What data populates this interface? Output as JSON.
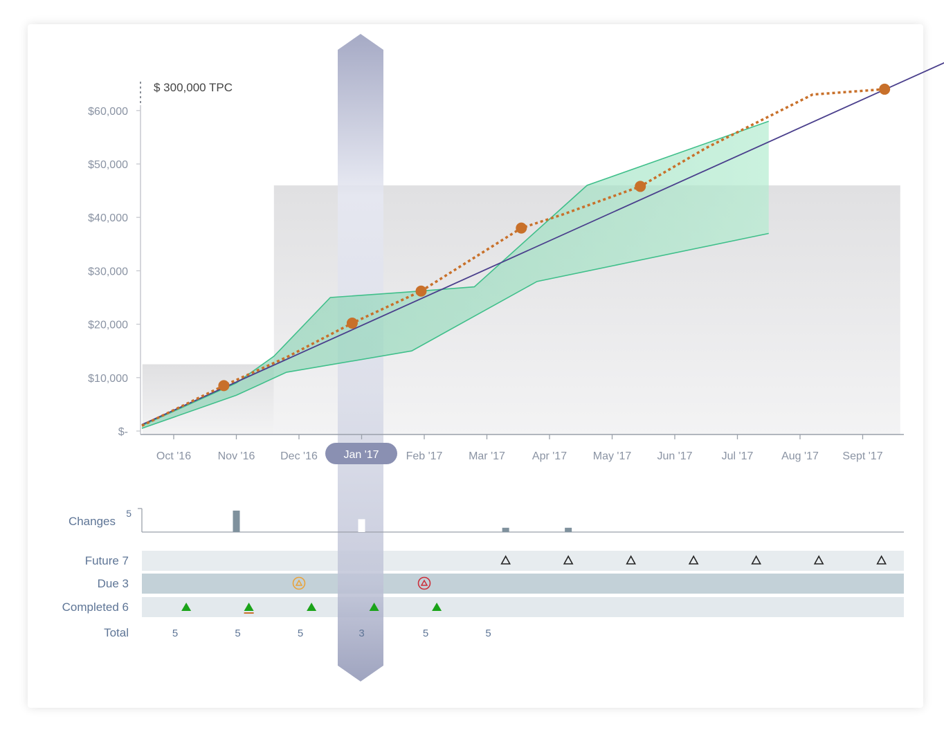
{
  "chart_data": {
    "type": "line",
    "tpc_label": "$ 300,000  TPC",
    "y_ticks": [
      "$-",
      "$10,000",
      "$20,000",
      "$30,000",
      "$40,000",
      "$50,000",
      "$60,000"
    ],
    "y_values": [
      0,
      10000,
      20000,
      30000,
      40000,
      50000,
      60000
    ],
    "ylim": [
      0,
      67000
    ],
    "months": [
      "Oct '16",
      "Nov '16",
      "Dec '16",
      "Jan '17",
      "Feb '17",
      "Mar '17",
      "Apr '17",
      "May '17",
      "Jun '17",
      "Jul '17",
      "Aug '17",
      "Sept '17"
    ],
    "selected_month": "Jan '17",
    "baseline": {
      "x": [
        0,
        12.5
      ],
      "y": [
        1200,
        70000
      ]
    },
    "band_upper": {
      "x": [
        0,
        1,
        1.6,
        2.5,
        3.7,
        4.8,
        6.6,
        9.5
      ],
      "y": [
        1000,
        9000,
        14000,
        25000,
        26000,
        27000,
        46000,
        58000
      ]
    },
    "band_lower": {
      "x": [
        0,
        1,
        1.8,
        3.8,
        5.8,
        9.5
      ],
      "y": [
        500,
        6700,
        11000,
        15000,
        28000,
        37000
      ]
    },
    "actual": {
      "x": [
        0,
        0.8,
        1.8,
        2.85,
        3.95,
        5.55,
        6.2,
        7.45,
        8.5,
        10.2,
        11.35
      ],
      "y": [
        1000,
        8500,
        13800,
        20200,
        26200,
        38000,
        40500,
        45800,
        53000,
        63000,
        64000
      ]
    },
    "actual_markers": [
      1,
      3,
      4,
      5,
      7,
      10
    ],
    "grey_regions": [
      {
        "x0": -0.5,
        "x1": 1.6,
        "y_top": 12500
      },
      {
        "x0": 1.6,
        "x1": 11.6,
        "y_top": 46000
      }
    ],
    "changes": {
      "label": "Changes",
      "max_label": "5",
      "bars": [
        {
          "month": 1,
          "value": 5
        },
        {
          "month": 3,
          "value": 3
        },
        {
          "month": 5.3,
          "value": 1
        },
        {
          "month": 6.3,
          "value": 1
        }
      ]
    },
    "rows": [
      {
        "label": "Future 7",
        "type": "future",
        "items": [
          5.3,
          6.3,
          7.3,
          8.3,
          9.3,
          10.3,
          11.3
        ]
      },
      {
        "label": "Due 3",
        "type": "due",
        "items": [
          {
            "month": 2,
            "status": "warning"
          },
          {
            "month": 4,
            "status": "overdue"
          }
        ]
      },
      {
        "label": "Completed 6",
        "type": "completed",
        "items": [
          0.2,
          1.2,
          2.2,
          3.2,
          4.2
        ]
      }
    ],
    "totals": {
      "label": "Total",
      "values": [
        "5",
        "5",
        "5",
        "3",
        "5",
        "5"
      ]
    },
    "colors": {
      "baseline": "#4a3f8c",
      "actual": "#c8702a",
      "band_fill": "#bfe8d6",
      "band_stroke": "#3fbf8a",
      "selector": "#8e94b4",
      "grey_region": "#e4e4e6",
      "completed": "#1aa319",
      "due_warning": "#e8a33c",
      "due_overdue": "#cc2f3a"
    }
  }
}
